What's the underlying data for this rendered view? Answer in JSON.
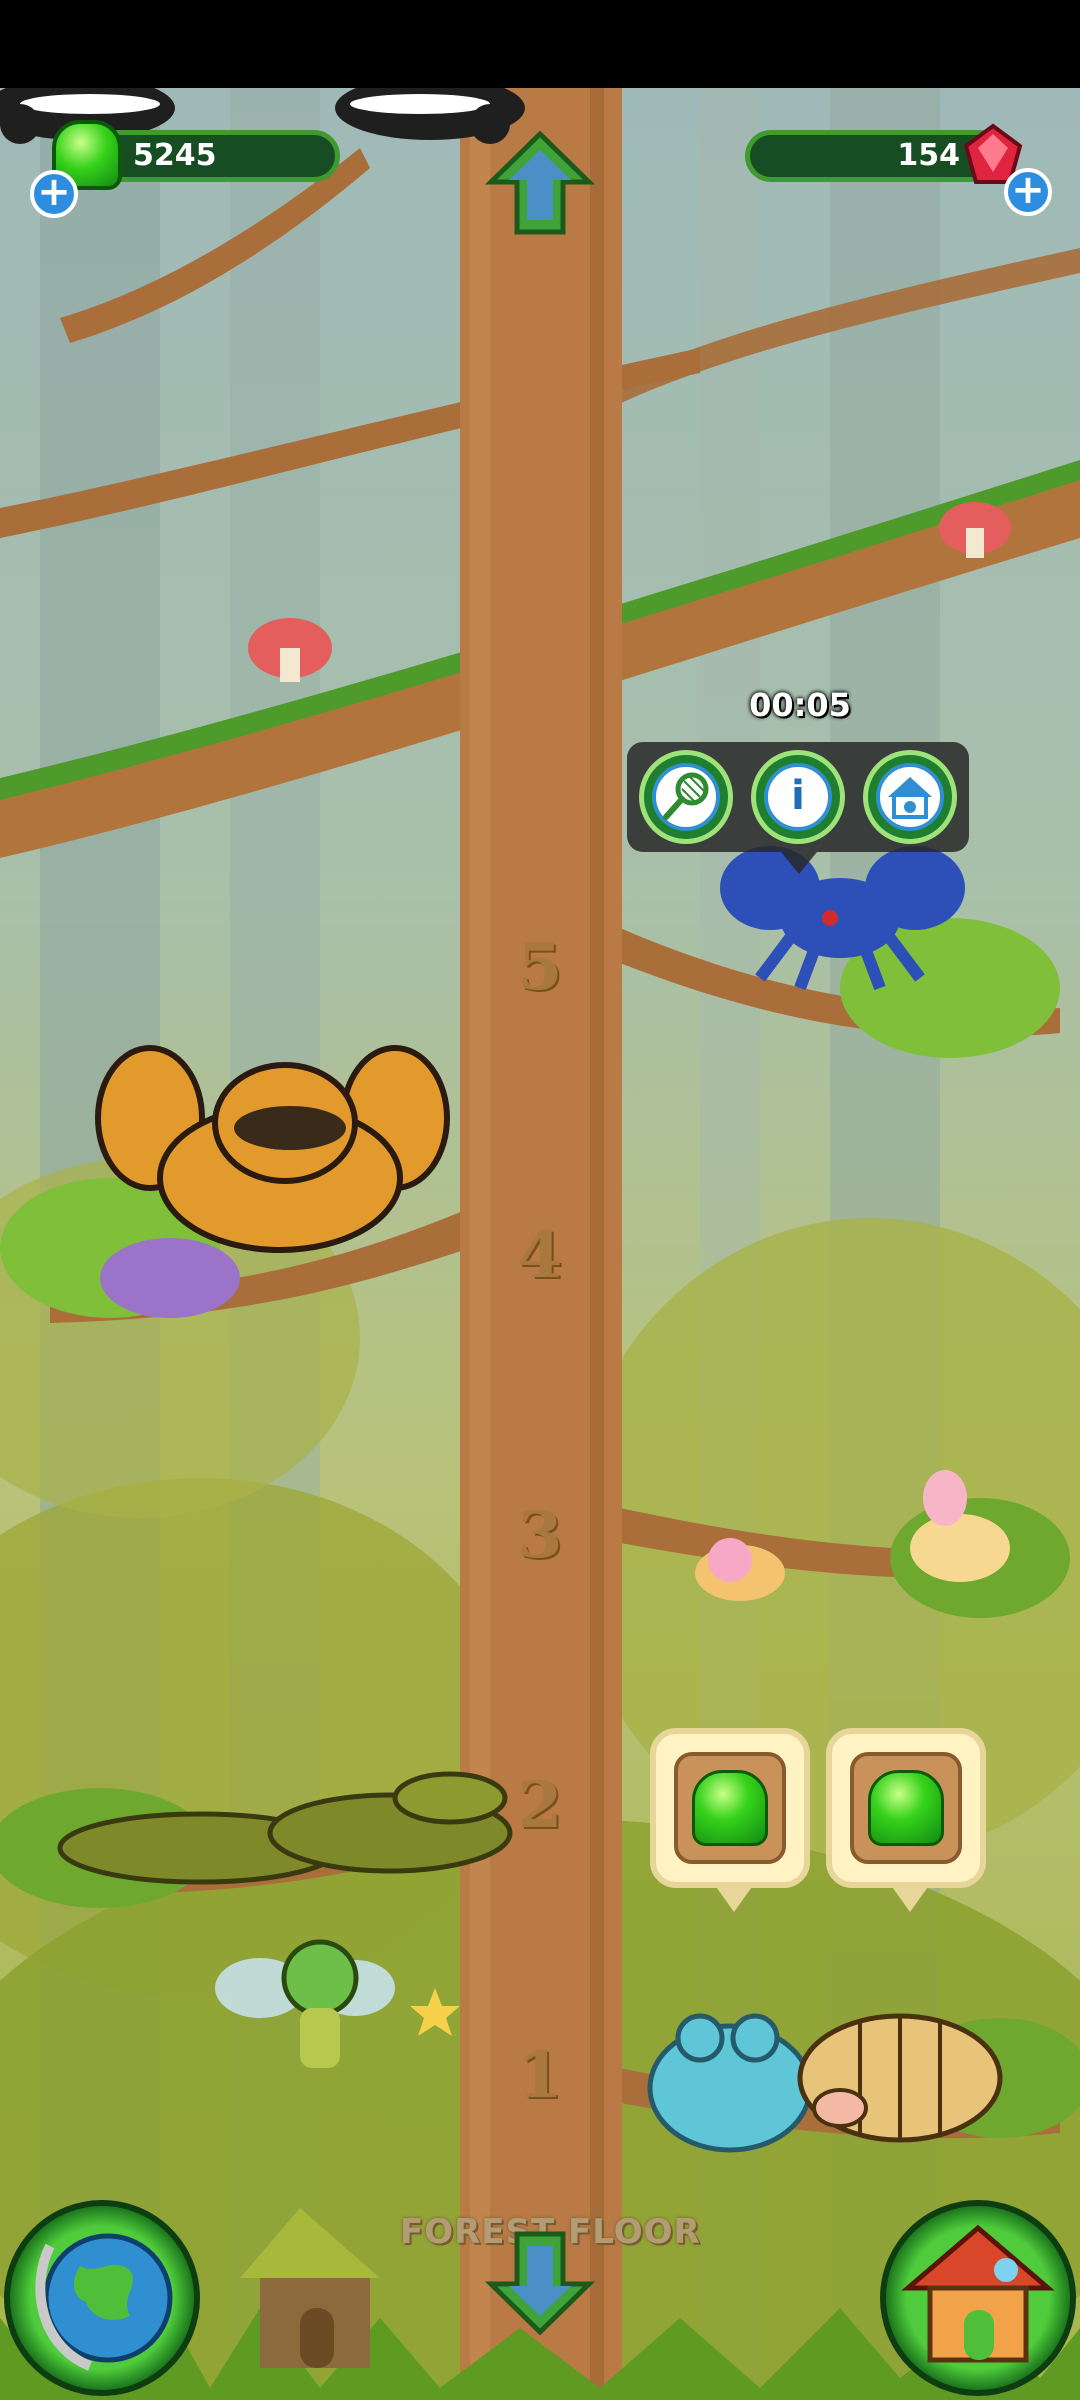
{
  "hud": {
    "jelly_count": "5245",
    "gem_count": "154",
    "plus": "+"
  },
  "actions": {
    "timer": "00:05",
    "info_symbol": "i"
  },
  "floor_label": "FOREST FLOOR",
  "levels": [
    "5",
    "4",
    "3",
    "2",
    "1"
  ],
  "icons": {
    "jelly": "green-jelly-icon",
    "gem": "red-gem-icon",
    "net": "net-icon",
    "info": "info-icon",
    "house": "pet-house-icon",
    "globe": "globe-icon",
    "home": "home-icon"
  },
  "colors": {
    "trunk": "#b97a45",
    "hud_bar": "#174d22",
    "hud_border": "#3f9a2f",
    "jelly": "#36d21b",
    "gem": "#e0233f",
    "plus": "#2d8ee0"
  }
}
